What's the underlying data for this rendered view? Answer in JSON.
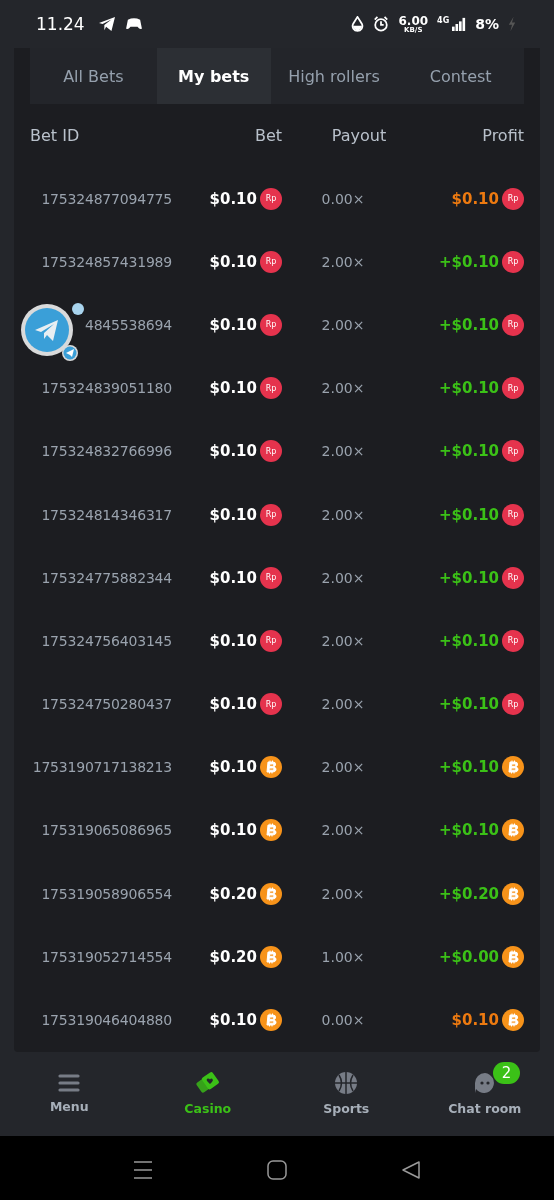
{
  "status_bar": {
    "time": "11.24",
    "speed": "6.00",
    "speed_unit": "KB/S",
    "network": "4G",
    "battery": "8%"
  },
  "tabs": [
    {
      "label": "All Bets",
      "selected": false
    },
    {
      "label": "My bets",
      "selected": true
    },
    {
      "label": "High rollers",
      "selected": false
    },
    {
      "label": "Contest",
      "selected": false
    }
  ],
  "table": {
    "columns": [
      "Bet ID",
      "Bet",
      "Payout",
      "Profit"
    ],
    "rows": [
      {
        "bet_id": "175324877094775",
        "bet": "$0.10",
        "kind": "rupiah",
        "bet_coin": "Rp",
        "payout": "0.00×",
        "profit": "$0.10",
        "profit_coin": "Rp",
        "won": false
      },
      {
        "bet_id": "175324857431989",
        "bet": "$0.10",
        "kind": "rupiah",
        "bet_coin": "Rp",
        "payout": "2.00×",
        "profit": "+$0.10",
        "profit_coin": "Rp",
        "won": true
      },
      {
        "bet_id": "4845538694",
        "bet": "$0.10",
        "kind": "rupiah",
        "bet_coin": "Rp",
        "payout": "2.00×",
        "profit": "+$0.10",
        "profit_coin": "Rp",
        "won": true
      },
      {
        "bet_id": "175324839051180",
        "bet": "$0.10",
        "kind": "rupiah",
        "bet_coin": "Rp",
        "payout": "2.00×",
        "profit": "+$0.10",
        "profit_coin": "Rp",
        "won": true
      },
      {
        "bet_id": "175324832766996",
        "bet": "$0.10",
        "kind": "rupiah",
        "bet_coin": "Rp",
        "payout": "2.00×",
        "profit": "+$0.10",
        "profit_coin": "Rp",
        "won": true
      },
      {
        "bet_id": "175324814346317",
        "bet": "$0.10",
        "kind": "rupiah",
        "bet_coin": "Rp",
        "payout": "2.00×",
        "profit": "+$0.10",
        "profit_coin": "Rp",
        "won": true
      },
      {
        "bet_id": "175324775882344",
        "bet": "$0.10",
        "kind": "rupiah",
        "bet_coin": "Rp",
        "payout": "2.00×",
        "profit": "+$0.10",
        "profit_coin": "Rp",
        "won": true
      },
      {
        "bet_id": "175324756403145",
        "bet": "$0.10",
        "kind": "rupiah",
        "bet_coin": "Rp",
        "payout": "2.00×",
        "profit": "+$0.10",
        "profit_coin": "Rp",
        "won": true
      },
      {
        "bet_id": "175324750280437",
        "bet": "$0.10",
        "kind": "rupiah",
        "bet_coin": "Rp",
        "payout": "2.00×",
        "profit": "+$0.10",
        "profit_coin": "Rp",
        "won": true
      },
      {
        "bet_id": "1753190717138213",
        "bet": "$0.10",
        "kind": "bitcoin",
        "payout": "2.00×",
        "profit": "+$0.10",
        "won": true
      },
      {
        "bet_id": "175319065086965",
        "bet": "$0.10",
        "kind": "bitcoin",
        "payout": "2.00×",
        "profit": "+$0.10",
        "won": true
      },
      {
        "bet_id": "175319058906554",
        "bet": "$0.20",
        "kind": "bitcoin",
        "payout": "2.00×",
        "profit": "+$0.20",
        "won": true
      },
      {
        "bet_id": "175319052714554",
        "bet": "$0.20",
        "kind": "bitcoin",
        "payout": "1.00×",
        "profit": "+$0.00",
        "won": true
      },
      {
        "bet_id": "175319046404880",
        "bet": "$0.10",
        "kind": "bitcoin",
        "payout": "0.00×",
        "profit": "$0.10",
        "won": false
      }
    ]
  },
  "bottom_nav": [
    {
      "label": "Menu",
      "selected": false
    },
    {
      "label": "Casino",
      "selected": true
    },
    {
      "label": "Sports",
      "selected": false
    },
    {
      "label": "Chat room",
      "selected": false,
      "badge": "2"
    }
  ]
}
